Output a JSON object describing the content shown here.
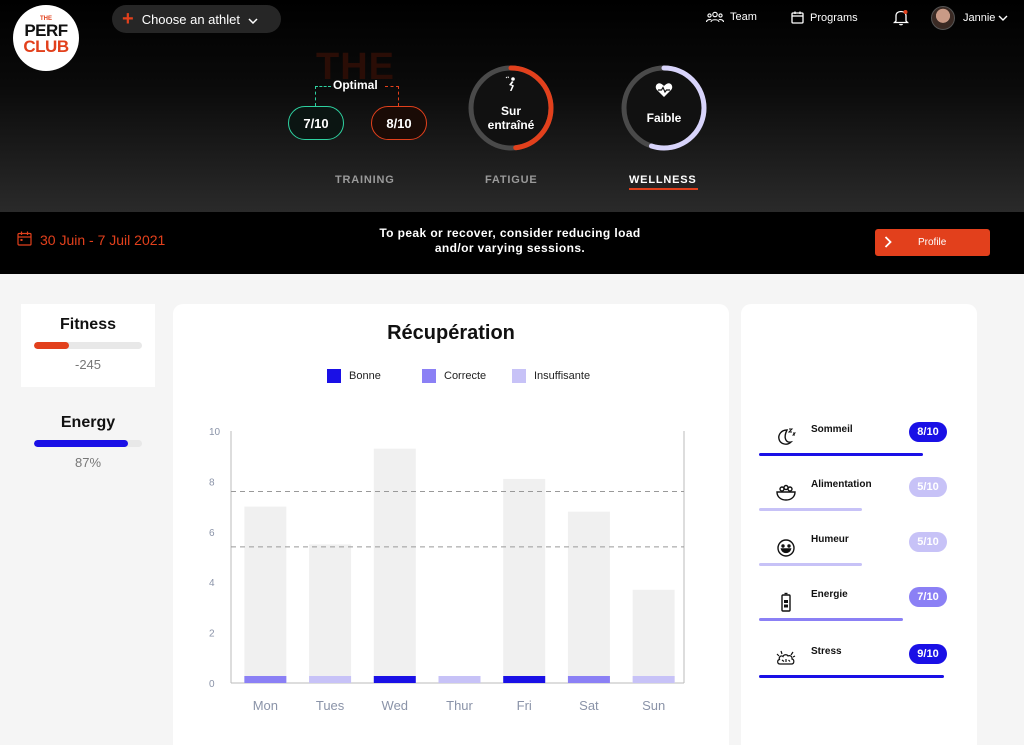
{
  "brand": {
    "line1": "THE",
    "line2": "PERF",
    "line3": "CLUB"
  },
  "header": {
    "athlete_select": "Choose an athlet",
    "nav": {
      "team": "Team",
      "programs": "Programs",
      "user": "Jannie"
    },
    "ghost": "THE",
    "training": {
      "label": "Optimal",
      "low": "7/10",
      "high": "8/10"
    },
    "fatigue": {
      "line1": "Sur",
      "line2": "entraîné",
      "level": 0.48
    },
    "wellness": {
      "text": "Faible",
      "level": 0.55
    },
    "tabs": [
      {
        "label": "TRAINING"
      },
      {
        "label": "FATIGUE"
      },
      {
        "label": "WELLNESS"
      }
    ],
    "active_tab": "WELLNESS"
  },
  "banner": {
    "date_range": "30 Juin - 7 Juil 2021",
    "advice_line1": "To peak or recover, consider reducing load",
    "advice_line2": "and/or varying sessions.",
    "profile_button": "Profile"
  },
  "stats": {
    "fitness": {
      "title": "Fitness",
      "value": "-245",
      "level": 0.32,
      "color": "#e2401c"
    },
    "energy": {
      "title": "Energy",
      "value": "87%",
      "level": 0.87,
      "color": "#1a10e6"
    }
  },
  "chart_data": {
    "type": "bar",
    "title": "Récupération",
    "legend": [
      {
        "name": "Bonne",
        "color": "#1a10e6"
      },
      {
        "name": "Correcte",
        "color": "#8b80f5"
      },
      {
        "name": "Insuffisante",
        "color": "#c7c2f7"
      }
    ],
    "categories": [
      "Mon",
      "Tues",
      "Wed",
      "Thur",
      "Fri",
      "Sat",
      "Sun"
    ],
    "values": [
      7,
      5.5,
      9.3,
      0,
      8.1,
      6.8,
      3.7
    ],
    "status": [
      "Correcte",
      "Insuffisante",
      "Bonne",
      "Insuffisante",
      "Bonne",
      "Correcte",
      "Insuffisante"
    ],
    "y_ticks": [
      0,
      2,
      4,
      6,
      8,
      10
    ],
    "ylim": [
      0,
      10
    ],
    "reference_lines": [
      5.4,
      7.6
    ],
    "colors": {
      "bar": "#f0f0f0",
      "reference": "#999999",
      "axis": "#bbbbbb",
      "tick_label": "#8a93a8"
    }
  },
  "wellness": {
    "items": [
      {
        "label": "Sommeil",
        "score": "8/10",
        "level": 0.8,
        "icon": "sleep-icon",
        "color": "#1a10e6",
        "line_color": "#1a10e6"
      },
      {
        "label": "Alimentation",
        "score": "5/10",
        "level": 0.5,
        "icon": "food-bowl-icon",
        "color": "#c7c2f7",
        "line_color": "#c7c2f7"
      },
      {
        "label": "Humeur",
        "score": "5/10",
        "level": 0.5,
        "icon": "smiley-icon",
        "color": "#c7c2f7",
        "line_color": "#c7c2f7"
      },
      {
        "label": "Energie",
        "score": "7/10",
        "level": 0.7,
        "icon": "battery-icon",
        "color": "#8b80f5",
        "line_color": "#8b80f5"
      },
      {
        "label": "Stress",
        "score": "9/10",
        "level": 0.9,
        "icon": "stress-brain-icon",
        "color": "#1a10e6",
        "line_color": "#1a10e6"
      }
    ]
  }
}
